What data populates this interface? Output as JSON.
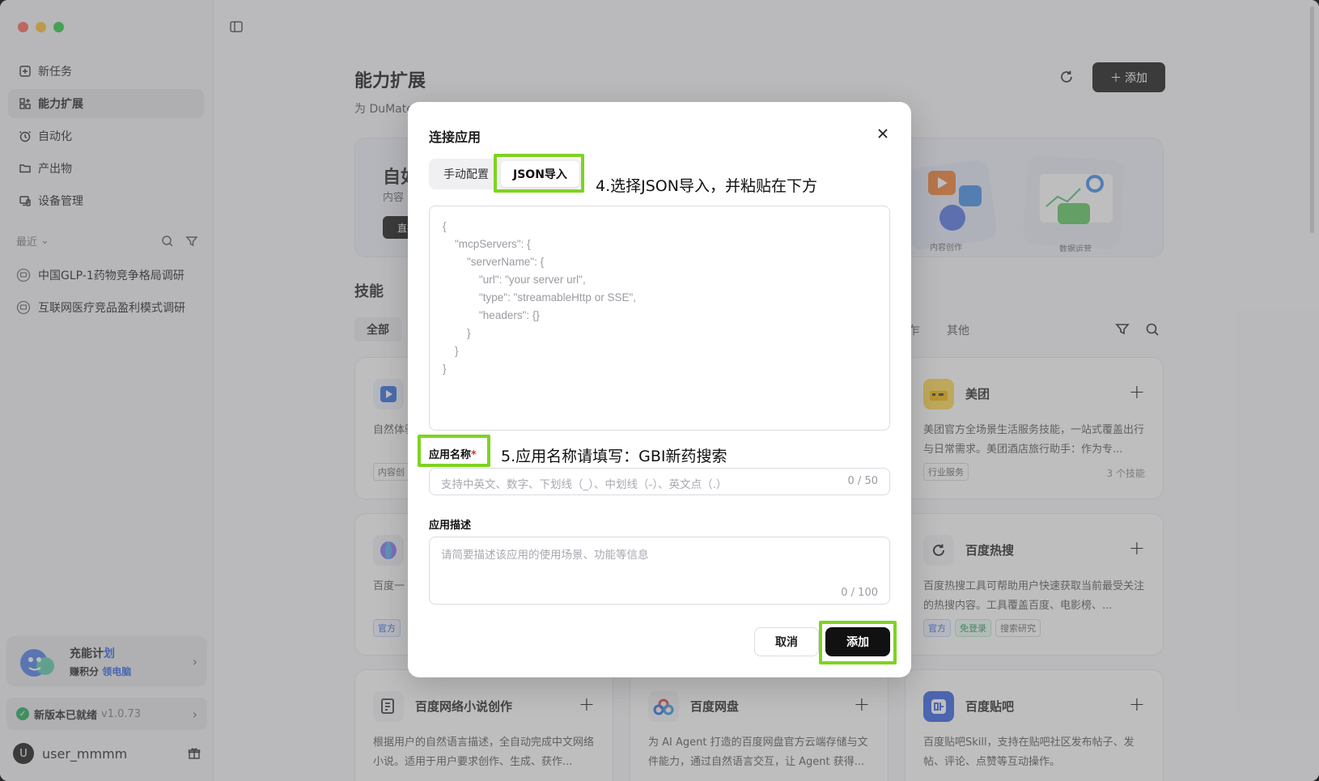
{
  "sidebar": {
    "nav": [
      {
        "label": "新任务",
        "icon": "new-task-icon"
      },
      {
        "label": "能力扩展",
        "icon": "extension-icon"
      },
      {
        "label": "自动化",
        "icon": "clock-icon"
      },
      {
        "label": "产出物",
        "icon": "folder-icon"
      },
      {
        "label": "设备管理",
        "icon": "device-icon"
      }
    ],
    "recent_label": "最近",
    "recent": [
      {
        "label": "中国GLP-1药物竞争格局调研"
      },
      {
        "label": "互联网医疗竞品盈利模式调研"
      }
    ],
    "promo": {
      "title_prefix": "充能计",
      "title_hl": "划",
      "sub_prefix": "赚积分 ",
      "sub_hl": "领电脑"
    },
    "update": {
      "label": "新版本已就绪",
      "version": "v1.0.73"
    },
    "user": {
      "initial": "U",
      "name": "user_mmmm"
    }
  },
  "main": {
    "title": "能力扩展",
    "subtitle": "为 DuMate",
    "add_label": "添加",
    "banner": {
      "title": "自如",
      "sub": "内容",
      "btn": "直播",
      "art_label_1": "内容创作",
      "art_label_2": "数据运营"
    },
    "section_title": "技能",
    "tab_all": "全部",
    "tab_cut": "乍",
    "tab_other": "其他",
    "cards": [
      {
        "name": "",
        "desc": "自然体验 荐，AI",
        "tags": [
          "内容创"
        ],
        "count": ""
      },
      {
        "name": "美团",
        "desc": "美团官方全场景生活服务技能，一站式覆盖出行与日常需求。美团酒店旅行助手：作为专...",
        "tags": [
          "行业服务"
        ],
        "count": "3 个技能"
      },
      {
        "name": "",
        "desc": "百度一 输入期",
        "tags": [
          "官方"
        ],
        "count": ""
      },
      {
        "name": "百度热搜",
        "desc": "百度热搜工具可帮助用户快速获取当前最受关注的热搜内容。工具覆盖百度、电影榜、...",
        "tags": [
          "官方",
          "免登录",
          "搜索研究"
        ],
        "count": ""
      },
      {
        "name": "百度网络小说创作",
        "desc": "根据用户的自然语言描述，全自动完成中文网络小说。适用于用户要求创作、生成、获作...",
        "tags": [],
        "count": ""
      },
      {
        "name": "百度网盘",
        "desc": "为 AI Agent 打造的百度网盘官方云端存储与文件能力，通过自然语言交互，让 Agent 获得...",
        "tags": [],
        "count": ""
      },
      {
        "name": "百度贴吧",
        "desc": "百度贴吧Skill，支持在贴吧社区发布帖子、发帖、评论、点赞等互动操作。",
        "tags": [],
        "count": ""
      }
    ]
  },
  "modal": {
    "title": "连接应用",
    "tabs": [
      "手动配置",
      "JSON导入"
    ],
    "annot_4": "4.选择JSON导入，并粘贴在下方",
    "json_placeholder": "{\n    \"mcpServers\": {\n        \"serverName\": {\n            \"url\": \"your server url\",\n            \"type\": \"streamableHttp or SSE\",\n            \"headers\": {}\n        }\n    }\n}",
    "name_label": "应用名称",
    "name_required": "*",
    "annot_5": "5.应用名称请填写：GBI新药搜索",
    "name_placeholder": "支持中英文、数字、下划线（_）、中划线（-）、英文点（.）",
    "name_count": "0 / 50",
    "desc_label": "应用描述",
    "desc_placeholder": "请简要描述该应用的使用场景、功能等信息",
    "desc_count": "0 / 100",
    "cancel": "取消",
    "add": "添加"
  },
  "colors": {
    "highlight": "#7ed321",
    "primary": "#111111",
    "link": "#2a5fe0"
  }
}
